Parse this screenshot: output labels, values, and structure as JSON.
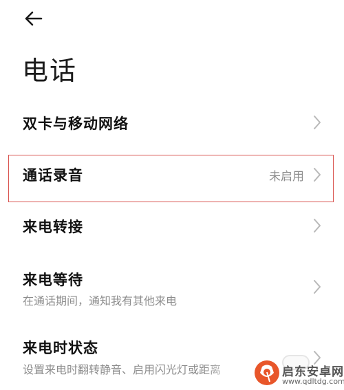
{
  "header": {
    "back_icon": "arrow-left-icon",
    "title": "电话"
  },
  "items": [
    {
      "label": "双卡与移动网络",
      "chevron_icon": "chevron-right-icon"
    },
    {
      "label": "通话录音",
      "value": "未启用",
      "chevron_icon": "chevron-right-icon",
      "highlighted": true,
      "highlight_color": "#d9534f"
    },
    {
      "label": "来电转接",
      "chevron_icon": "chevron-right-icon"
    },
    {
      "label": "来电等待",
      "subtitle": "在通话期间，通知我有其他来电",
      "chevron_icon": "chevron-right-icon"
    },
    {
      "label": "来电时状态",
      "subtitle": "设置来电时翻转静音、启用闪光灯或距离",
      "chevron_icon": "chevron-right-icon"
    }
  ],
  "watermark": {
    "name": "启东安卓网",
    "url": "www.qdltdg.com",
    "color": "#e8562a"
  }
}
